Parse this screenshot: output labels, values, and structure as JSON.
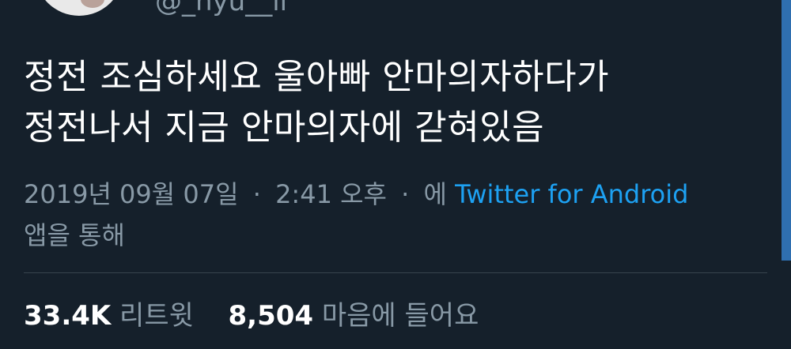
{
  "user": {
    "handle": "@_hyu__ii"
  },
  "tweet": {
    "lines": [
      "정전 조심하세요 울아빠 안마의자하다가",
      "정전나서 지금 안마의자에 갇혀있음"
    ]
  },
  "meta": {
    "date": "2019년 09월 07일",
    "separator": "·",
    "time": "2:41 오후",
    "via_prefix": "에",
    "source": "Twitter for Android",
    "via_suffix": "앱을 통해"
  },
  "stats": {
    "retweets_count": "33.4K",
    "retweets_label": "리트윗",
    "likes_count": "8,504",
    "likes_label": "마음에 들어요"
  },
  "colors": {
    "background": "#15202b",
    "link": "#1da1f2",
    "secondary_text": "#8899a6"
  }
}
